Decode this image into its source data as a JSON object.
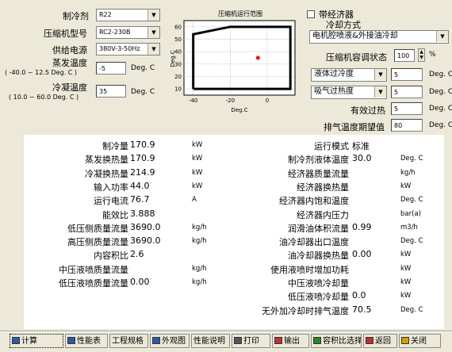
{
  "inputs": {
    "refrigerant": {
      "label": "制冷剂",
      "value": "R22"
    },
    "model": {
      "label": "压缩机型号",
      "value": "RC2-230B"
    },
    "power": {
      "label": "供给电源",
      "value": "380V-3-50Hz"
    },
    "evap": {
      "label": "蒸发温度",
      "range": "( -40.0 ~ 12.5 Deg. C )",
      "value": "-5",
      "unit": "Deg. C"
    },
    "cond": {
      "label": "冷凝温度",
      "range": "( 10.0 ~ 60.0 Deg. C )",
      "value": "35",
      "unit": "Deg. C"
    }
  },
  "chart": {
    "title": "压缩机运行范围",
    "ylabel": "Deg.C",
    "xlabel": "Deg.C"
  },
  "chart_data": {
    "type": "scatter",
    "title": "压缩机运行范围",
    "xlabel": "Deg.C",
    "ylabel": "Deg.C",
    "x_ticks": [
      "-40",
      "-20",
      "0"
    ],
    "y_ticks": [
      "10",
      "20",
      "30",
      "40",
      "50",
      "60"
    ],
    "xlim": [
      -45,
      15
    ],
    "ylim": [
      5,
      65
    ],
    "envelope": [
      [
        -40,
        10
      ],
      [
        -40,
        54
      ],
      [
        -20,
        60
      ],
      [
        12.5,
        60
      ],
      [
        12.5,
        10
      ],
      [
        -40,
        10
      ]
    ],
    "point": {
      "x": -5,
      "y": 35,
      "color": "#ff0000"
    }
  },
  "right": {
    "economizer_label": "带经济器",
    "cooling_label": "冷却方式",
    "cooling_value": "电机腔喷液&外接油冷却",
    "capacity_label": "压缩机容调状态",
    "capacity_value": "100",
    "capacity_unit": "%",
    "subcool_sel": "液体过冷度",
    "subcool_value": "5",
    "subcool_unit": "Deg. C",
    "superheat_sel": "吸气过热度",
    "superheat_value": "5",
    "superheat_unit": "Deg. C",
    "eff_label": "有效过热",
    "eff_value": "5",
    "eff_unit": "Deg. C",
    "discharge_label": "排气温度期望值",
    "discharge_value": "80",
    "discharge_unit": "Deg. C"
  },
  "results_left": [
    {
      "label": "制冷量",
      "value": "170.9",
      "unit": "kW"
    },
    {
      "label": "蒸发换热量",
      "value": "170.9",
      "unit": "kW"
    },
    {
      "label": "冷凝换热量",
      "value": "214.9",
      "unit": "kW"
    },
    {
      "label": "输入功率",
      "value": "44.0",
      "unit": "kW"
    },
    {
      "label": "运行电流",
      "value": "76.7",
      "unit": "A"
    },
    {
      "label": "能效比",
      "value": "3.888",
      "unit": ""
    },
    {
      "label": "低压侧质量流量",
      "value": "3690.0",
      "unit": "kg/h"
    },
    {
      "label": "高压侧质量流量",
      "value": "3690.0",
      "unit": "kg/h"
    },
    {
      "label": "内容积比",
      "value": "2.6",
      "unit": ""
    },
    {
      "label": "中压液喷质量流量",
      "value": "",
      "unit": "kg/h"
    },
    {
      "label": "低压液喷质量流量",
      "value": "0.00",
      "unit": "kg/h"
    }
  ],
  "results_right": [
    {
      "label": "运行模式",
      "value": "标准",
      "unit": ""
    },
    {
      "label": "制冷剂液体温度",
      "value": "30.0",
      "unit": "Deg. C"
    },
    {
      "label": "经济器质量流量",
      "value": "",
      "unit": "kg/h"
    },
    {
      "label": "经济器换热量",
      "value": "",
      "unit": "kW"
    },
    {
      "label": "经济器内饱和温度",
      "value": "",
      "unit": "Deg. C"
    },
    {
      "label": "经济器内压力",
      "value": "",
      "unit": "bar(a)"
    },
    {
      "label": "润滑油体积流量",
      "value": "0.99",
      "unit": "m3/h"
    },
    {
      "label": "油冷却器出口温度",
      "value": "",
      "unit": "Deg. C"
    },
    {
      "label": "油冷却器换热量",
      "value": "0.00",
      "unit": "kW"
    },
    {
      "label": "使用液喷时增加功耗",
      "value": "",
      "unit": "kW"
    },
    {
      "label": "中压液喷冷却量",
      "value": "",
      "unit": "kW"
    },
    {
      "label": "低压液喷冷却量",
      "value": "0.0",
      "unit": "kW"
    },
    {
      "label": "无外加冷却时排气温度",
      "value": "70.5",
      "unit": "Deg. C"
    }
  ],
  "toolbar": [
    {
      "label": "计算",
      "icon": "calculator-icon"
    },
    {
      "label": "性能表",
      "icon": "table-icon"
    },
    {
      "label": "工程规格",
      "icon": ""
    },
    {
      "label": "外观图",
      "icon": "diamond-icon"
    },
    {
      "label": "性能说明",
      "icon": ""
    },
    {
      "label": "打印",
      "icon": "printer-icon"
    },
    {
      "label": "输出",
      "icon": "export-icon"
    },
    {
      "label": "容积比选择",
      "icon": "ratio-icon"
    },
    {
      "label": "返回",
      "icon": "back-icon"
    },
    {
      "label": "关闭",
      "icon": "close-icon"
    }
  ]
}
